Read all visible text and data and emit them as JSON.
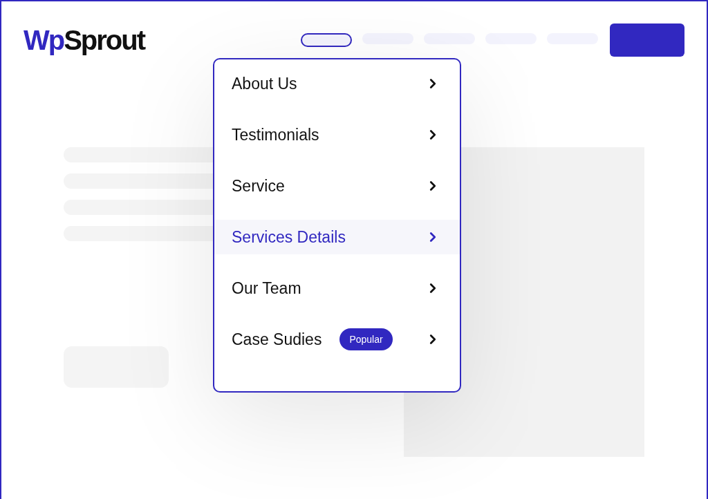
{
  "logo": {
    "parts": [
      "Wp",
      "Sprout"
    ]
  },
  "nav_items": [
    {
      "selected": true
    },
    {
      "selected": false
    },
    {
      "selected": false
    },
    {
      "selected": false
    },
    {
      "selected": false
    }
  ],
  "dropdown": {
    "items": [
      {
        "label": "About Us",
        "selected": false
      },
      {
        "label": "Testimonials",
        "selected": false
      },
      {
        "label": "Service",
        "selected": false
      },
      {
        "label": "Services Details",
        "selected": true
      },
      {
        "label": "Our Team",
        "selected": false
      },
      {
        "label": "Case Sudies",
        "selected": false,
        "badge": "Popular"
      }
    ]
  }
}
